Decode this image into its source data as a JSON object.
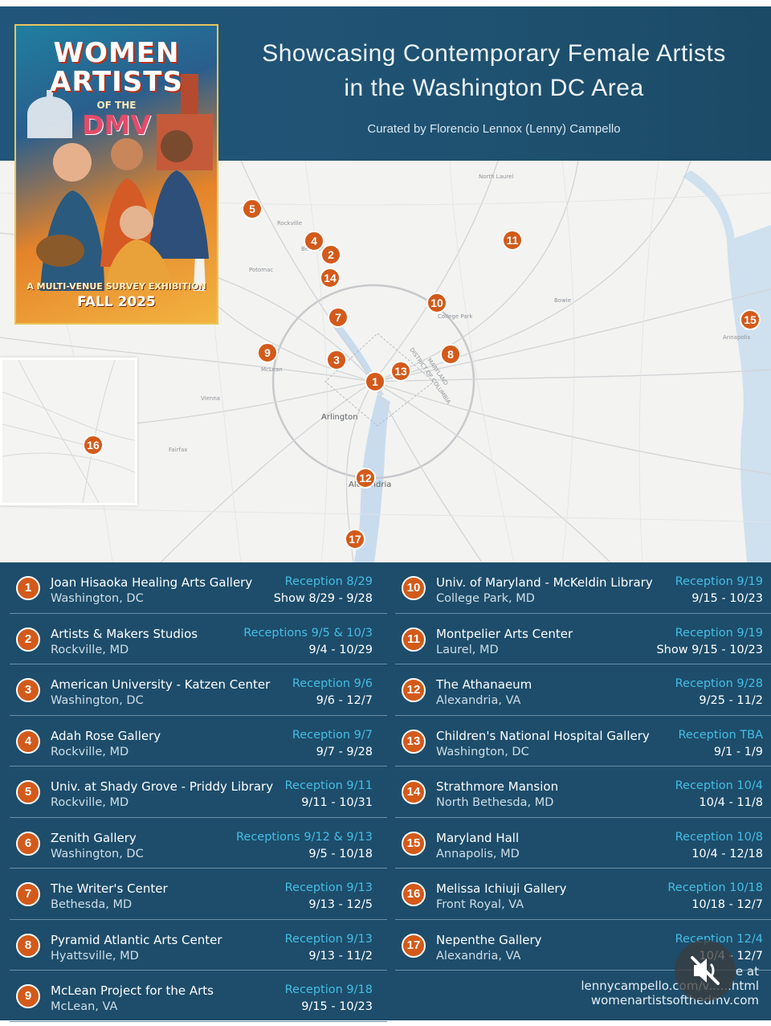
{
  "header": {
    "title_line1": "Showcasing Contemporary Female Artists",
    "title_line2": "in the Washington DC Area",
    "curated": "Curated by Florencio Lennox (Lenny) Campello"
  },
  "poster": {
    "line1": "WOMEN",
    "line2": "ARTISTS",
    "line3": "OF THE",
    "line4": "DMV",
    "line5": "A MULTI-VENUE SURVEY EXHIBITION",
    "line6": "FALL 2025"
  },
  "map": {
    "labels": {
      "arlington": "Arlington",
      "alexandria": "Alexandria",
      "rockville": "Rockville",
      "mclean": "McLean",
      "laurel": "North Laurel",
      "college_park": "College Park",
      "bowie": "Bowie",
      "fairfax": "Fairfax",
      "annapolis": "Annapolis",
      "district": "DISTRICT OF COLUMBIA",
      "maryland": "MARYLAND",
      "bethesda": "Bethesda",
      "potomac": "Potomac",
      "vienna": "Vienna"
    },
    "pins": [
      "5",
      "4",
      "2",
      "14",
      "11",
      "10",
      "7",
      "15",
      "9",
      "3",
      "8",
      "13",
      "1",
      "12",
      "17",
      "16"
    ]
  },
  "venues": [
    {
      "num": "1",
      "name": "Joan Hisaoka Healing Arts Gallery",
      "city": "Washington, DC",
      "reception": "Reception 8/29",
      "dates": "Show 8/29  - 9/28"
    },
    {
      "num": "2",
      "name": "Artists & Makers Studios",
      "city": "Rockville, MD",
      "reception": "Receptions 9/5 & 10/3",
      "dates": "9/4 - 10/29"
    },
    {
      "num": "3",
      "name": "American University - Katzen Center",
      "city": "Washington, DC",
      "reception": "Reception 9/6",
      "dates": "9/6 - 12/7"
    },
    {
      "num": "4",
      "name": "Adah Rose Gallery",
      "city": "Rockville, MD",
      "reception": "Reception 9/7",
      "dates": "9/7 - 9/28"
    },
    {
      "num": "5",
      "name": "Univ. at Shady Grove - Priddy Library",
      "city": "Rockville, MD",
      "reception": "Reception 9/11",
      "dates": "9/11 - 10/31"
    },
    {
      "num": "6",
      "name": "Zenith Gallery",
      "city": "Washington, DC",
      "reception": "Receptions 9/12 & 9/13",
      "dates": "9/5 - 10/18"
    },
    {
      "num": "7",
      "name": "The Writer's Center",
      "city": "Bethesda, MD",
      "reception": "Reception 9/13",
      "dates": "9/13 - 12/5"
    },
    {
      "num": "8",
      "name": "Pyramid Atlantic Arts Center",
      "city": "Hyattsville, MD",
      "reception": "Reception 9/13",
      "dates": "9/13 - 11/2"
    },
    {
      "num": "9",
      "name": "McLean Project for the Arts",
      "city": "McLean, VA",
      "reception": "Reception 9/18",
      "dates": "9/15 - 10/23"
    },
    {
      "num": "10",
      "name": "Univ. of Maryland - McKeldin Library",
      "city": "College Park, MD",
      "reception": "Reception 9/19",
      "dates": "9/15 - 10/23"
    },
    {
      "num": "11",
      "name": "Montpelier Arts Center",
      "city": "Laurel, MD",
      "reception": "Reception 9/19",
      "dates": "Show 9/15 - 10/23"
    },
    {
      "num": "12",
      "name": "The Athanaeum",
      "city": "Alexandria, VA",
      "reception": "Reception 9/28",
      "dates": "9/25 - 11/2"
    },
    {
      "num": "13",
      "name": "Children's National Hospital Gallery",
      "city": "Washington, DC",
      "reception": "Reception TBA",
      "dates": "9/1 - 1/9"
    },
    {
      "num": "14",
      "name": "Strathmore Mansion",
      "city": "North Bethesda, MD",
      "reception": "Reception 10/4",
      "dates": "10/4 - 11/8"
    },
    {
      "num": "15",
      "name": "Maryland Hall",
      "city": "Annapolis, MD",
      "reception": "Reception 10/8",
      "dates": "10/4 - 12/18"
    },
    {
      "num": "16",
      "name": "Melissa Ichiuji Gallery",
      "city": "Front Royal, VA",
      "reception": "Reception 10/18",
      "dates": "10/18 - 12/7"
    },
    {
      "num": "17",
      "name": "Nepenthe Gallery",
      "city": "Alexandria, VA",
      "reception": "Reception 12/4",
      "dates": "10/4 - 12/7"
    }
  ],
  "footer": {
    "line1": "e at",
    "line2": "lennycampello.com/v......html",
    "line3": "womenartistsofthedmv.com"
  },
  "icons": {
    "mute": "speaker-muted-icon"
  },
  "colors": {
    "panel": "#1d4d6b",
    "accent": "#d35a1a",
    "reception": "#46bde4"
  }
}
